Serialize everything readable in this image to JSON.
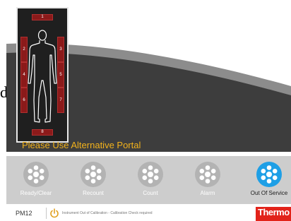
{
  "stray_text": "d",
  "screen": {
    "title": "Out Of Calibration",
    "portal_message": "Please Use Alternative Portal",
    "zones": [
      {
        "label": "1",
        "state": "alarm"
      },
      {
        "label": "2",
        "state": "alarm"
      },
      {
        "label": "3",
        "state": "alarm"
      },
      {
        "label": "4",
        "state": "alarm"
      },
      {
        "label": "5",
        "state": "alarm"
      },
      {
        "label": "6",
        "state": "alarm"
      },
      {
        "label": "7",
        "state": "alarm"
      },
      {
        "label": "8",
        "state": "alarm"
      }
    ]
  },
  "buttons": [
    {
      "label": "Ready/Clear",
      "active": false
    },
    {
      "label": "Recount",
      "active": false
    },
    {
      "label": "Count",
      "active": false
    },
    {
      "label": "Alarm",
      "active": false
    },
    {
      "label": "Out Of Service",
      "active": true
    }
  ],
  "status_bar": {
    "code": "PM12",
    "message": "Instrument Out of Calibration - Calibration Check required"
  },
  "brand": {
    "logo_text": "Thermo"
  },
  "colors": {
    "panel": "#3d3d3d",
    "accent_text": "#f2b21c",
    "zone_alarm": "#8b1a1a",
    "active_button": "#1e9fe6",
    "inactive_button": "#b3b3b3",
    "brand_red": "#e2231a"
  }
}
